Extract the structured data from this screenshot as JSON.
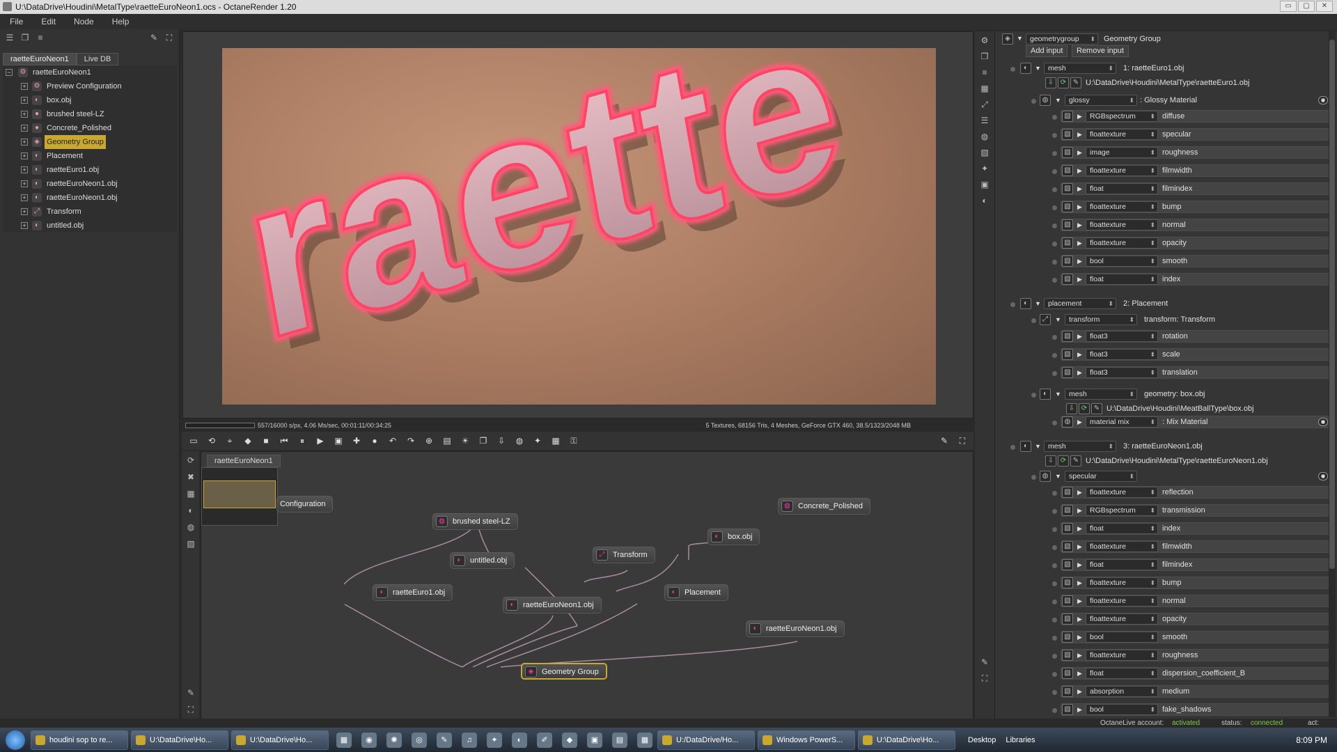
{
  "title": "U:\\DataDrive\\Houdini\\MetalType\\raetteEuroNeon1.ocs - OctaneRender 1.20",
  "window_buttons": [
    "▭",
    "▢",
    "✕"
  ],
  "menu": [
    "File",
    "Edit",
    "Node",
    "Help"
  ],
  "tree_tabs": [
    "raetteEuroNeon1",
    "Live DB"
  ],
  "tree": {
    "root": "raetteEuroNeon1",
    "items": [
      "Preview Configuration",
      "box.obj",
      "brushed steel-LZ",
      "Concrete_Polished",
      "Geometry Group",
      "Placement",
      "raetteEuro1.obj",
      "raetteEuroNeon1.obj",
      "raetteEuroNeon1.obj",
      "Transform",
      "untitled.obj"
    ],
    "selected": "Geometry Group"
  },
  "render_text": "raette",
  "status_left": "557/16000 s/px, 4.06 Ms/sec, 00:01:11/00:34:25",
  "status_right": "5 Textures, 68156 Tris, 4 Meshes, GeForce GTX 460, 38.5/1323/2048 MB",
  "graph_tab": "raetteEuroNeon1",
  "nodes": {
    "config": "Configuration",
    "brushed": "brushed steel-LZ",
    "concrete": "Concrete_Polished",
    "box": "box.obj",
    "untitled": "untitled.obj",
    "transform": "Transform",
    "raetteEuro1": "raetteEuro1.obj",
    "raetteEuroNeon1a": "raetteEuroNeon1.obj",
    "placement": "Placement",
    "raetteEuroNeon1b": "raetteEuroNeon1.obj",
    "geometrygroup": "Geometry Group"
  },
  "inspector": {
    "header_type": "geometrygroup",
    "header_name": "Geometry Group",
    "add_input": "Add input",
    "remove_input": "Remove input",
    "mesh1_type": "mesh",
    "mesh1_name": "1: raetteEuro1.obj",
    "mesh1_path": "U:\\DataDrive\\Houdini\\MetalType\\raetteEuro1.obj",
    "glossy_type": "glossy",
    "glossy_name": ": Glossy Material",
    "glossy_pins": [
      [
        "RGBspectrum",
        "diffuse"
      ],
      [
        "floattexture",
        "specular"
      ],
      [
        "image",
        "roughness"
      ],
      [
        "floattexture",
        "filmwidth"
      ],
      [
        "float",
        "filmindex"
      ],
      [
        "floattexture",
        "bump"
      ],
      [
        "floattexture",
        "normal"
      ],
      [
        "floattexture",
        "opacity"
      ],
      [
        "bool",
        "smooth"
      ],
      [
        "float",
        "index"
      ]
    ],
    "placement_type": "placement",
    "placement_name": "2: Placement",
    "transform_type": "transform",
    "transform_name": "transform: Transform",
    "transform_pins": [
      [
        "float3",
        "rotation"
      ],
      [
        "float3",
        "scale"
      ],
      [
        "float3",
        "translation"
      ]
    ],
    "geometry_type": "mesh",
    "geometry_name": "geometry: box.obj",
    "box_path": "U:\\DataDrive\\Houdini\\MeatBallType\\box.obj",
    "mix_type": "material mix",
    "mix_name": ": Mix Material",
    "mesh3_type": "mesh",
    "mesh3_name": "3: raetteEuroNeon1.obj",
    "mesh3_path": "U:\\DataDrive\\Houdini\\MetalType\\raetteEuroNeon1.obj",
    "specular_type": "specular",
    "specular_pins": [
      [
        "floattexture",
        "reflection"
      ],
      [
        "RGBspectrum",
        "transmission"
      ],
      [
        "float",
        "index"
      ],
      [
        "floattexture",
        "filmwidth"
      ],
      [
        "float",
        "filmindex"
      ],
      [
        "floattexture",
        "bump"
      ],
      [
        "floattexture",
        "normal"
      ],
      [
        "floattexture",
        "opacity"
      ],
      [
        "bool",
        "smooth"
      ],
      [
        "floattexture",
        "roughness"
      ],
      [
        "float",
        "dispersion_coefficient_B"
      ],
      [
        "absorption",
        "medium"
      ],
      [
        "bool",
        "fake_shadows"
      ]
    ]
  },
  "statusbar": {
    "account_label": "OctaneLive account:",
    "account_value": "activated",
    "status_label": "status:",
    "status_value": "connected",
    "act_label": "act:"
  },
  "taskbar": {
    "tasks": [
      "houdini sop to re...",
      "U:\\DataDrive\\Ho...",
      "U:\\DataDrive\\Ho...",
      "U:/DataDrive/Ho...",
      "Windows PowerS...",
      "U:\\DataDrive\\Ho..."
    ],
    "desktop": "Desktop",
    "libraries": "Libraries",
    "time": "8:09 PM"
  },
  "colors": {
    "accent": "#c8a82e",
    "status_ok": "#7fcf3f",
    "neon": "#ff5a7a"
  }
}
